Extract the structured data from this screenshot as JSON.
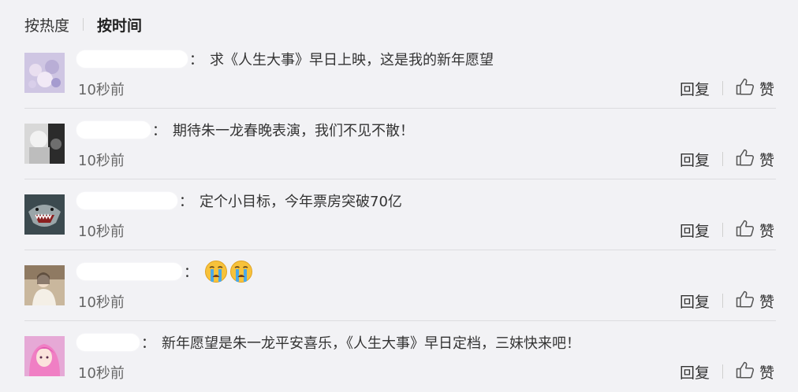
{
  "sort_tabs": {
    "by_hot": "按热度",
    "by_time": "按时间",
    "active": "by_time"
  },
  "comments": [
    {
      "avatar": "avatar-icon",
      "text": "求《人生大事》早日上映，这是我的新年愿望",
      "time": "10秒前",
      "reply_label": "回复",
      "like_label": "赞"
    },
    {
      "avatar": "avatar-icon",
      "text": "期待朱一龙春晚表演，我们不见不散！",
      "time": "10秒前",
      "reply_label": "回复",
      "like_label": "赞"
    },
    {
      "avatar": "avatar-icon",
      "text": "定个小目标，今年票房突破70亿",
      "time": "10秒前",
      "reply_label": "回复",
      "like_label": "赞"
    },
    {
      "avatar": "avatar-icon",
      "text": "",
      "emojis": [
        "crying-face-emoji",
        "crying-face-emoji"
      ],
      "time": "10秒前",
      "reply_label": "回复",
      "like_label": "赞"
    },
    {
      "avatar": "avatar-icon",
      "text": "新年愿望是朱一龙平安喜乐，《人生大事》早日定档，三妹快来吧！",
      "time": "10秒前",
      "reply_label": "回复",
      "like_label": "赞"
    }
  ],
  "colors": {
    "background": "#f2f2f5",
    "text": "#333333",
    "muted": "#666666",
    "divider": "#dcdcdf"
  }
}
